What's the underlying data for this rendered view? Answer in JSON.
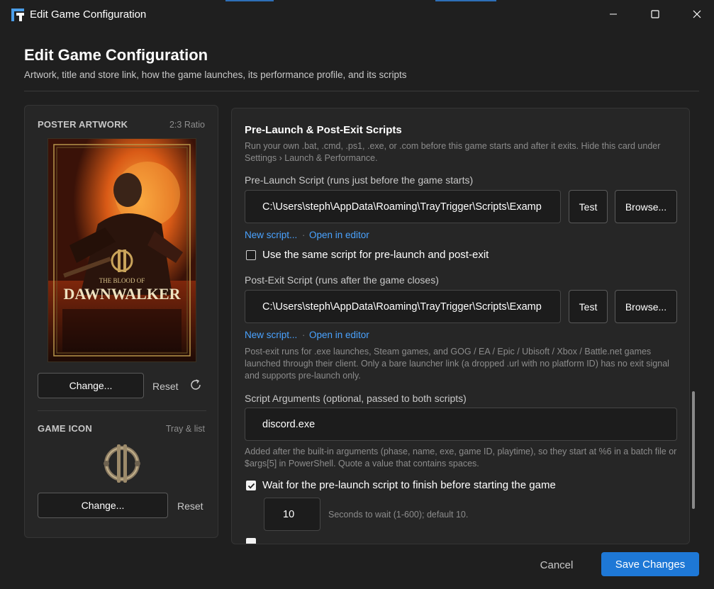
{
  "window": {
    "title": "Edit Game Configuration"
  },
  "header": {
    "title": "Edit Game Configuration",
    "subtitle": "Artwork, title and store link, how the game launches, its performance profile, and its scripts"
  },
  "poster": {
    "label": "POSTER ARTWORK",
    "hint": "2:3 Ratio",
    "art_line1": "THE BLOOD OF",
    "art_line2": "DAWNWALKER",
    "change_label": "Change...",
    "reset_label": "Reset"
  },
  "game_icon": {
    "label": "GAME ICON",
    "hint": "Tray & list",
    "change_label": "Change...",
    "reset_label": "Reset"
  },
  "scripts": {
    "title": "Pre-Launch & Post-Exit Scripts",
    "description": "Run your own .bat, .cmd, .ps1, .exe, or .com before this game starts and after it exits. Hide this card under Settings › Launch & Performance.",
    "pre_launch": {
      "label": "Pre-Launch Script (runs just before the game starts)",
      "value": "C:\\Users\\steph\\AppData\\Roaming\\TrayTrigger\\Scripts\\Examp",
      "test_label": "Test",
      "browse_label": "Browse...",
      "new_link": "New script...",
      "separator": "·",
      "open_link": "Open in editor"
    },
    "same_script": {
      "label": "Use the same script for pre-launch and post-exit",
      "checked": false
    },
    "post_exit": {
      "label": "Post-Exit Script (runs after the game closes)",
      "value": "C:\\Users\\steph\\AppData\\Roaming\\TrayTrigger\\Scripts\\Examp",
      "test_label": "Test",
      "browse_label": "Browse...",
      "new_link": "New script...",
      "separator": "·",
      "open_link": "Open in editor"
    },
    "post_exit_note": "Post-exit runs for .exe launches, Steam games, and GOG / EA / Epic / Ubisoft / Xbox / Battle.net games launched through their client. Only a bare launcher link (a dropped .url with no platform ID) has no exit signal and supports pre-launch only.",
    "arguments": {
      "label": "Script Arguments (optional, passed to both scripts)",
      "value": "discord.exe",
      "note": "Added after the built-in arguments (phase, name, exe, game ID, playtime), so they start at %6 in a batch file or $args[5] in PowerShell. Quote a value that contains spaces."
    },
    "wait": {
      "label": "Wait for the pre-launch script to finish before starting the game",
      "checked": true,
      "seconds_value": "10",
      "seconds_hint": "Seconds to wait (1-600); default 10."
    }
  },
  "footer": {
    "cancel_label": "Cancel",
    "save_label": "Save Changes"
  },
  "colors": {
    "accent": "#1e78d6",
    "link": "#4aa3ff",
    "background": "#1f1f1f",
    "card": "#262626"
  }
}
